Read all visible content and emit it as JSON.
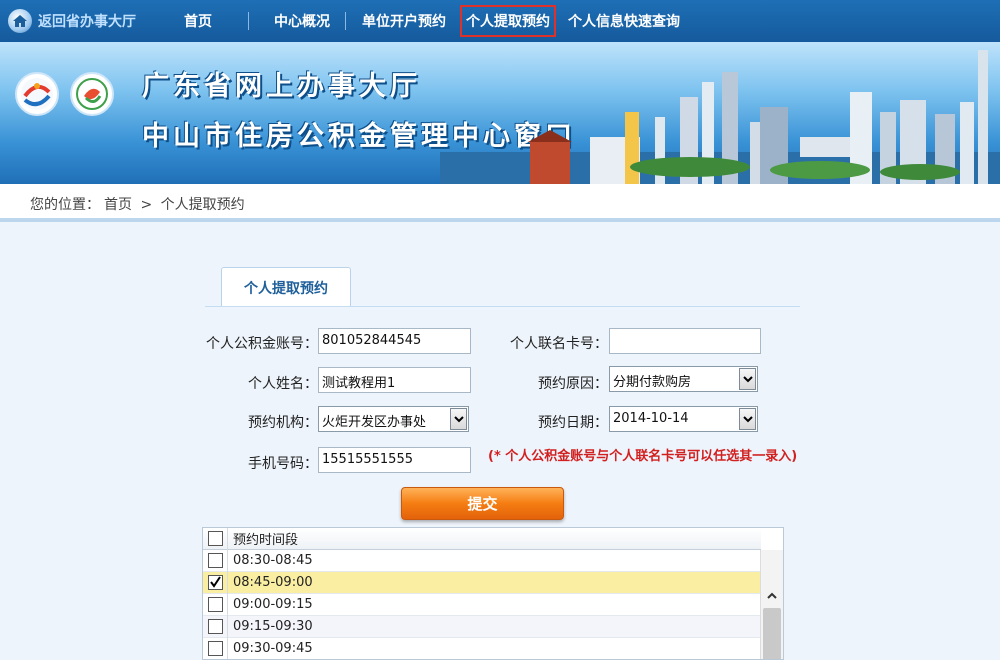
{
  "topnav": {
    "home_link": "返回省办事大厅",
    "items": [
      "首页",
      "中心概况",
      "单位开户预约",
      "个人提取预约",
      "个人信息快速查询"
    ],
    "active_index": 3
  },
  "banner": {
    "title_line1": "广东省网上办事大厅",
    "title_line2": "中山市住房公积金管理中心窗口"
  },
  "breadcrumb": {
    "prefix": "您的位置：",
    "home": "首页",
    "separator": ">",
    "current": "个人提取预约"
  },
  "tab": {
    "label": "个人提取预约"
  },
  "form": {
    "account_label": "个人公积金账号：",
    "account_value": "801052844545",
    "card_label": "个人联名卡号：",
    "card_value": "",
    "name_label": "个人姓名：",
    "name_value": "测试教程用1",
    "reason_label": "预约原因：",
    "reason_value": "分期付款购房",
    "org_label": "预约机构：",
    "org_value": "火炬开发区办事处",
    "date_label": "预约日期：",
    "date_value": "2014-10-14",
    "phone_label": "手机号码：",
    "phone_value": "15515551555",
    "note": "(* 个人公积金账号与个人联名卡号可以任选其一录入)",
    "submit_label": "提交"
  },
  "slots": {
    "header": "预约时间段",
    "rows": [
      {
        "time": "08:30-08:45",
        "checked": false
      },
      {
        "time": "08:45-09:00",
        "checked": true
      },
      {
        "time": "09:00-09:15",
        "checked": false
      },
      {
        "time": "09:15-09:30",
        "checked": false
      },
      {
        "time": "09:30-09:45",
        "checked": false
      }
    ]
  }
}
